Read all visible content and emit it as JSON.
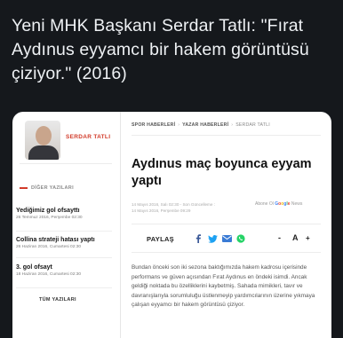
{
  "tweet": {
    "text": "Yeni MHK Başkanı Serdar Tatlı: \"Fırat Aydınus eyyamcı bir hakem görüntüsü çiziyor.\" (2016)"
  },
  "sidebar": {
    "author_name": "SERDAR TATLI",
    "section_title": "DİĞER YAZILARI",
    "items": [
      {
        "title": "Yediğimiz gol ofsayttı",
        "date": "26 Temmuz 2016, Perşembe 02:30"
      },
      {
        "title": "Collina strateji hatası yaptı",
        "date": "26 Haziran 2016, Cumartesi 02:30"
      },
      {
        "title": "3. gol ofsayt",
        "date": "18 Haziran 2016, Cumartesi 02:30"
      }
    ],
    "all_button": "TÜM YAZILARI"
  },
  "article": {
    "breadcrumb": [
      "SPOR HABERLERİ",
      "YAZAR HABERLERİ",
      "SERDAR TATLI"
    ],
    "title": "Aydınus maç boyunca eyyam yaptı",
    "meta_published": "14 Mayıs 2016, Salı 02:30 - Son Güncelleme :",
    "meta_updated": "14 Mayıs 2016, Perşembe 09:29",
    "google_news_prefix": "Abone Ol",
    "google_news": [
      "G",
      "o",
      "o",
      "g",
      "l",
      "e",
      " News"
    ],
    "share_label": "PAYLAŞ",
    "font_decrease": "-",
    "font_increase": "A",
    "font_plus": "+",
    "body": "Bundan önceki son iki sezona baktığımızda hakem kadrosu içerisinde performans ve güven açısından Fırat Aydınus en öndeki isimdi. Ancak geldiği noktada bu özelliklerini kaybetmiş. Sahada mimikleri, tavır ve davranışlarıyla sorumluluğu üstlenmeyip yardımcılarının üzerine yıkmaya çalışan eyyamcı bir hakem görüntüsü çiziyor."
  },
  "colors": {
    "background": "#15181c",
    "accent": "#d23b2a",
    "facebook": "#3b5998",
    "twitter": "#1da1f2",
    "email": "#3a7bd5",
    "whatsapp": "#25d366"
  }
}
